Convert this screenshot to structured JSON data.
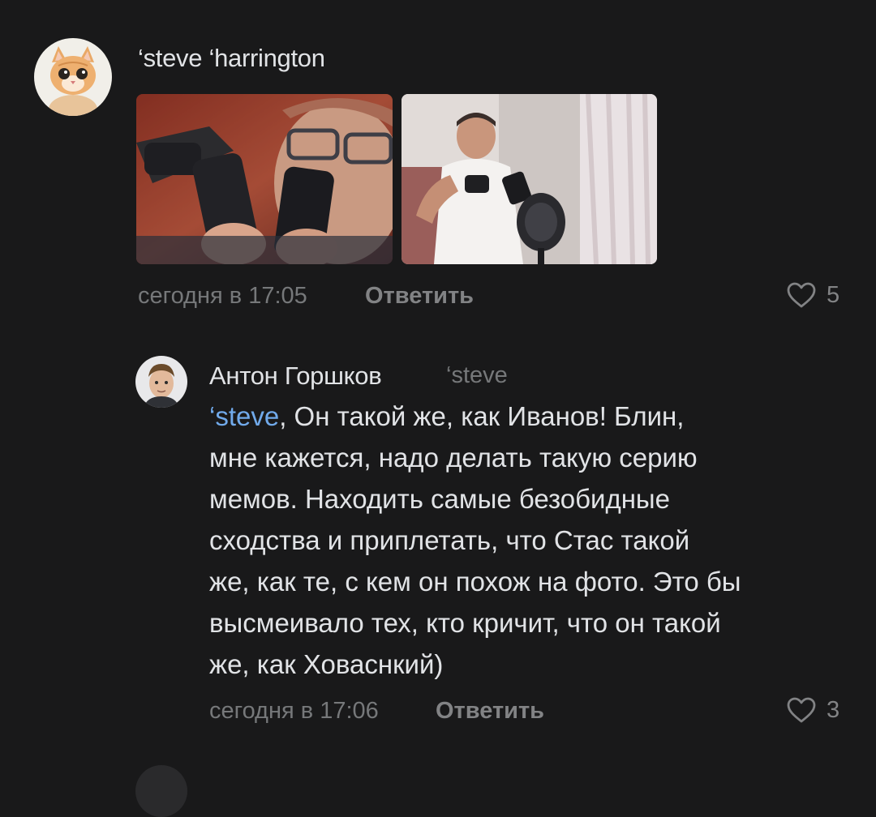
{
  "comments": [
    {
      "author": "‘steve ‘harrington",
      "avatar_icon": "kitten-avatar",
      "photos": [
        "photo-man-with-phones-glasses",
        "photo-man-with-phones-microphone"
      ],
      "time": "сегодня в 17:05",
      "reply_label": "Ответить",
      "likes": "5"
    }
  ],
  "reply": {
    "author": "Антон Горшков",
    "reply_to": "‘steve",
    "avatar_icon": "man-avatar",
    "mention": "‘steve",
    "text": ", Он такой же, как Иванов! Блин,\nмне кажется, надо делать такую серию\nмемов. Находить самые безобидные\nсходства и приплетать, что Стас такой\nже, как те, с кем он похож на фото. Это бы\nвысмеивало тех, кто кричит, что он такой\nже, как Ховаснкий)",
    "time": "сегодня в 17:06",
    "reply_label": "Ответить",
    "likes": "3"
  },
  "colors": {
    "background": "#19191a",
    "text": "#e1e3e6",
    "secondary": "#76787a",
    "mention": "#71aaeb"
  }
}
